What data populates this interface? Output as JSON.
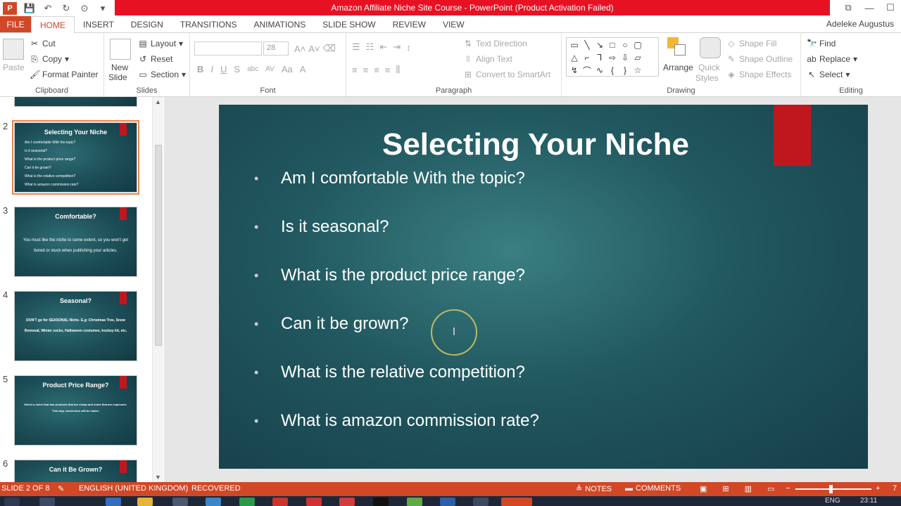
{
  "window": {
    "title": "Amazon Affiliate Niche Site Course - PowerPoint (Product Activation Failed)",
    "app_badge": "P",
    "help": "?",
    "restore": "⧉",
    "minimize": "—",
    "maximize": "☐"
  },
  "tabs": [
    "FILE",
    "HOME",
    "INSERT",
    "DESIGN",
    "TRANSITIONS",
    "ANIMATIONS",
    "SLIDE SHOW",
    "REVIEW",
    "VIEW"
  ],
  "active_tab": "HOME",
  "user": "Adeleke Augustus",
  "ribbon": {
    "clipboard": {
      "label": "Clipboard",
      "paste": "Paste",
      "cut": "Cut",
      "copy": "Copy",
      "format_painter": "Format Painter"
    },
    "slides": {
      "label": "Slides",
      "new_slide_1": "New",
      "new_slide_2": "Slide",
      "layout": "Layout",
      "reset": "Reset",
      "section": "Section"
    },
    "font": {
      "label": "Font",
      "font_name": "",
      "font_size": "28"
    },
    "paragraph": {
      "label": "Paragraph",
      "text_direction": "Text Direction",
      "align_text": "Align Text",
      "convert_smartart": "Convert to SmartArt"
    },
    "drawing": {
      "label": "Drawing",
      "arrange": "Arrange",
      "quick_styles_1": "Quick",
      "quick_styles_2": "Styles",
      "shape_fill": "Shape Fill",
      "shape_outline": "Shape Outline",
      "shape_effects": "Shape Effects"
    },
    "editing": {
      "label": "Editing",
      "find": "Find",
      "replace": "Replace",
      "select": "Select"
    }
  },
  "thumbnails": [
    {
      "num": "2",
      "title": "Selecting Your Niche",
      "bullets": [
        "Am I comfortable With the topic?",
        "Is it seasonal?",
        "What is the product price range?",
        "Can it be grown?",
        "What is the relative competition?",
        "What is amazon commission rate?"
      ],
      "selected": true
    },
    {
      "num": "3",
      "title": "Comfortable?",
      "body": "You must like the niche to some extent, so you won't get bored or stuck when publishing your articles."
    },
    {
      "num": "4",
      "title": "Seasonal?",
      "body": "DON'T go for SEASONAL Niche. E.g: Christmas Tree, Snow Removal, Winter socks, Halloween costumes, hockey kit, etc."
    },
    {
      "num": "5",
      "title": "Product Price Range?",
      "body": "Select a niche that has products that are cheap and some that are expensive. This way, conversion will be easier."
    },
    {
      "num": "6",
      "title": "Can it Be Grown?"
    }
  ],
  "slide": {
    "title": "Selecting Your Niche",
    "bullets": [
      "Am I comfortable With the topic?",
      "Is it seasonal?",
      "What is the product price range?",
      "Can it be grown?",
      "What is the relative competition?",
      "What is amazon commission rate?"
    ]
  },
  "status": {
    "slide_count": "SLIDE 2 OF 8",
    "language": "ENGLISH (UNITED KINGDOM)",
    "recovered": "RECOVERED",
    "notes": "NOTES",
    "comments": "COMMENTS",
    "zoom_short": "7"
  },
  "taskbar": {
    "lang": "ENG",
    "time": "23:11"
  },
  "colors": {
    "accent": "#d24726",
    "title_red": "#e81123",
    "slide_bg": "#21575f",
    "slide_tag": "#c0171f"
  }
}
